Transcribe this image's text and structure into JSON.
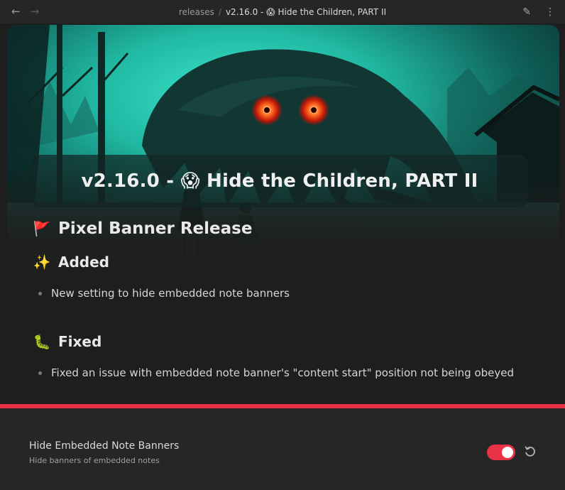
{
  "header": {
    "breadcrumb_folder": "releases",
    "breadcrumb_separator": "/",
    "breadcrumb_file": "v2.16.0 - 😱 Hide the Children, PART II",
    "back_icon": "←",
    "forward_icon": "→",
    "edit_icon": "✎",
    "more_icon": "⋮"
  },
  "note": {
    "title": "v2.16.0 - 😱 Hide the Children, PART II",
    "heading": {
      "emoji": "🚩",
      "text": "Pixel Banner Release"
    },
    "sections": [
      {
        "emoji": "✨",
        "text": "Added",
        "bullets": [
          "New setting to hide embedded note banners"
        ]
      },
      {
        "emoji": "🐛",
        "text": "Fixed",
        "bullets": [
          "Fixed an issue with embedded note banner's \"content start\" position not being obeyed"
        ]
      }
    ]
  },
  "setting": {
    "name": "Hide Embedded Note Banners",
    "description": "Hide banners of embedded notes",
    "enabled": true
  },
  "colors": {
    "accent": "#e93147",
    "background": "#1e1e1e",
    "banner_teal": "#1fc9b0"
  }
}
